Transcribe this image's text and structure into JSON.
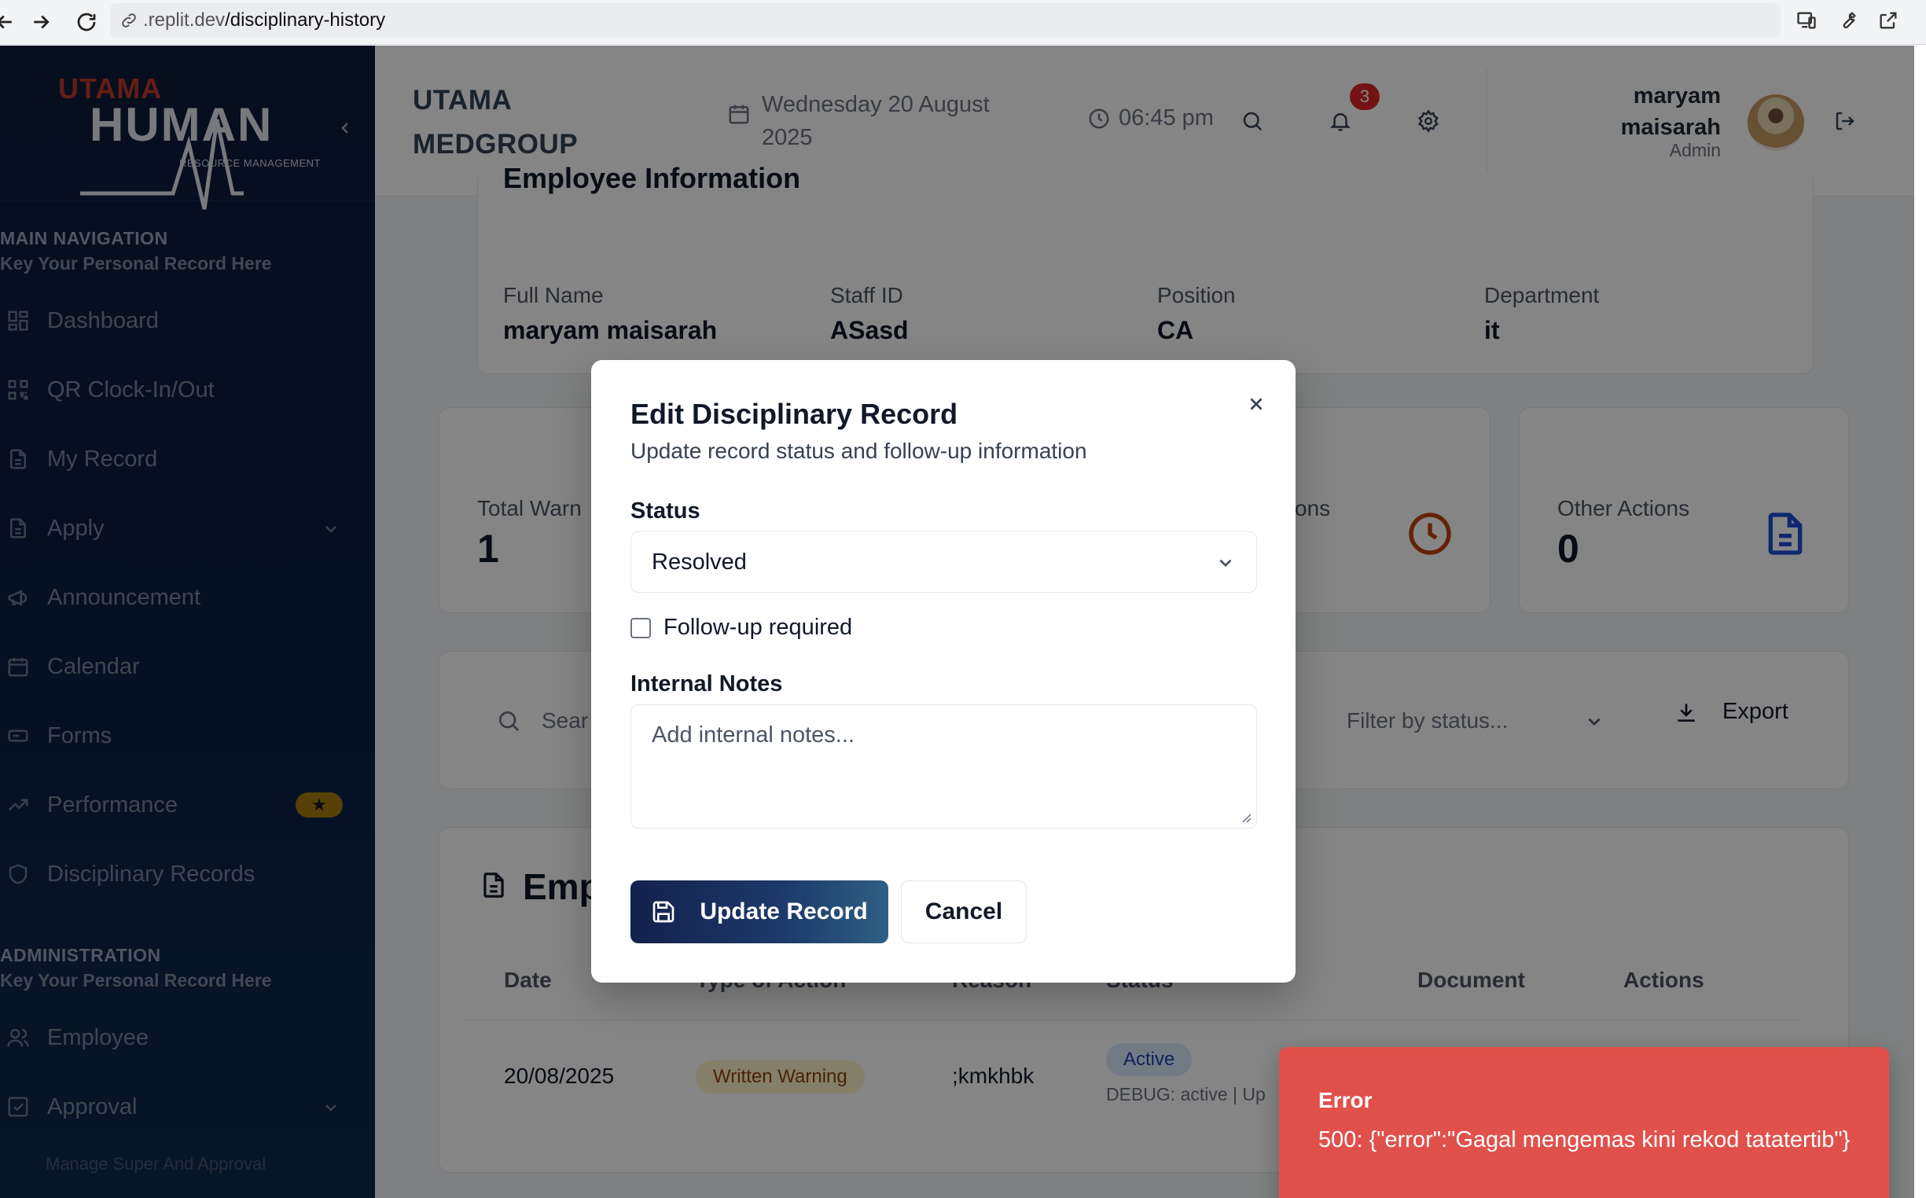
{
  "browser": {
    "url_prefix": ".replit.dev",
    "url_path": "/disciplinary-history"
  },
  "sidebar": {
    "logo_top": "UTAMA",
    "logo_main": "HUMAN",
    "logo_sub": "RESOURCE MANAGEMENT",
    "main_nav_title": "MAIN NAVIGATION",
    "main_nav_sub": "Key Your Personal Record Here",
    "items": [
      {
        "label": "Dashboard",
        "icon": "grid-icon"
      },
      {
        "label": "QR Clock-In/Out",
        "icon": "qr-icon"
      },
      {
        "label": "My Record",
        "icon": "document-icon"
      },
      {
        "label": "Apply",
        "icon": "document-icon"
      },
      {
        "label": "Announcement",
        "icon": "megaphone-icon"
      },
      {
        "label": "Calendar",
        "icon": "calendar-icon"
      },
      {
        "label": "Forms",
        "icon": "form-icon"
      },
      {
        "label": "Performance",
        "icon": "trend-icon",
        "badge": "★"
      },
      {
        "label": "Disciplinary Records",
        "icon": "shield-icon"
      }
    ],
    "admin_title": "ADMINISTRATION",
    "admin_sub": "Key Your Personal Record Here",
    "admin_items": [
      {
        "label": "Employee",
        "icon": "users-icon"
      },
      {
        "label": "Approval",
        "icon": "check-square-icon"
      }
    ],
    "manage_text": "Manage Super And Approval"
  },
  "header": {
    "company_line1": "UTAMA",
    "company_line2": "MEDGROUP",
    "date": "Wednesday 20 August 2025",
    "time": "06:45 pm",
    "notification_count": "3",
    "user_name_line1": "maryam",
    "user_name_line2": "maisarah",
    "user_role": "Admin"
  },
  "employee_info": {
    "title": "Employee Information",
    "fields": [
      {
        "label": "Full Name",
        "value": "maryam maisarah"
      },
      {
        "label": "Staff ID",
        "value": "ASasd"
      },
      {
        "label": "Position",
        "value": "CA"
      },
      {
        "label": "Department",
        "value": "it"
      }
    ]
  },
  "stats": {
    "total_label": "Total Warn",
    "total_value": "1",
    "suspensions_label": "ons",
    "other_label": "Other Actions",
    "other_value": "0"
  },
  "filters": {
    "search_placeholder": "Sear",
    "status_placeholder": "Filter by status...",
    "export_label": "Export"
  },
  "records": {
    "title": "Emp",
    "headers": [
      "Date",
      "Type of Action",
      "Reason",
      "Status",
      "Document",
      "Actions"
    ],
    "rows": [
      {
        "date": "20/08/2025",
        "type": "Written Warning",
        "reason": ";kmkhbk",
        "status": "Active",
        "debug": "DEBUG: active | Up"
      }
    ]
  },
  "modal": {
    "title": "Edit Disciplinary Record",
    "description": "Update record status and follow-up information",
    "status_label": "Status",
    "status_value": "Resolved",
    "followup_label": "Follow-up required",
    "notes_label": "Internal Notes",
    "notes_placeholder": "Add internal notes...",
    "update_label": "Update Record",
    "cancel_label": "Cancel"
  },
  "toast": {
    "title": "Error",
    "message": "500: {\"error\":\"Gagal mengemas kini rekod tatatertib\"}"
  },
  "colors": {
    "sidebar_bg": "#0e1b3a",
    "primary_button": "#1d3a6b",
    "error_toast": "#e0514b",
    "notification_badge": "#dc2626"
  }
}
